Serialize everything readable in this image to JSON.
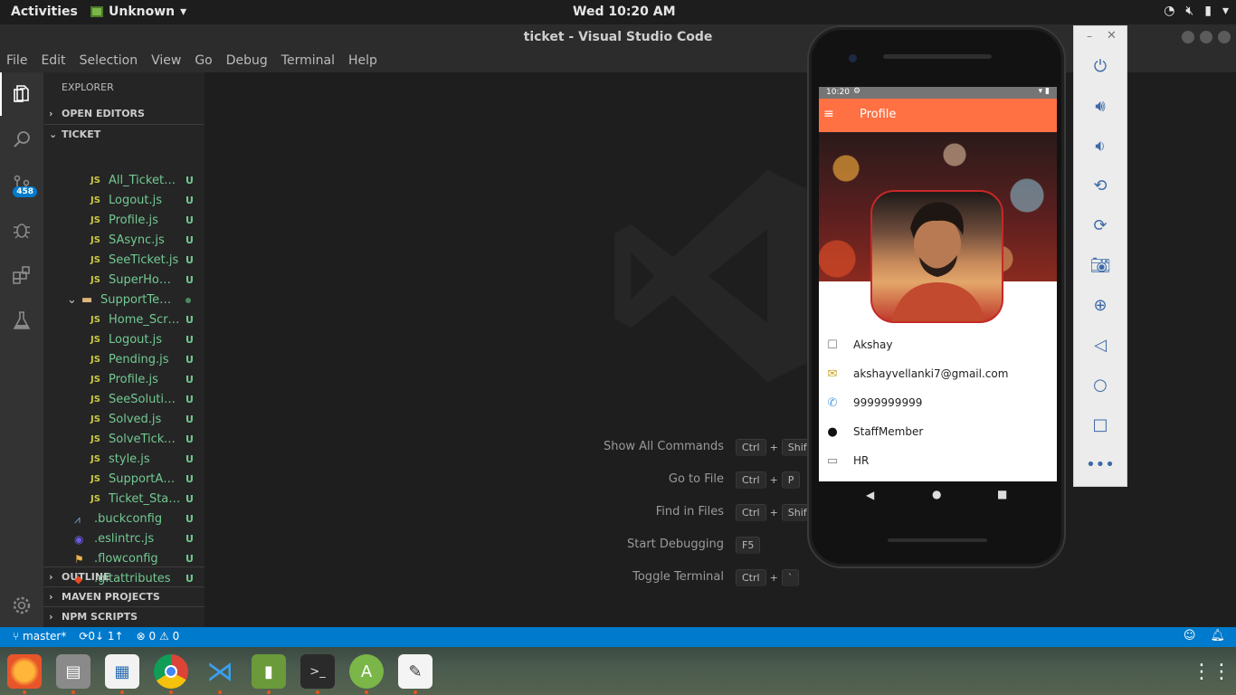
{
  "topbar": {
    "activities": "Activities",
    "app_name": "Unknown",
    "clock": "Wed 10:20 AM"
  },
  "window": {
    "title": "ticket - Visual Studio Code"
  },
  "menu": [
    "File",
    "Edit",
    "Selection",
    "View",
    "Go",
    "Debug",
    "Terminal",
    "Help"
  ],
  "activity": {
    "scm_badge": "458"
  },
  "explorer": {
    "title": "EXPLORER",
    "open_editors": "OPEN EDITORS",
    "project": "TICKET",
    "files": [
      {
        "name": "All_Tickets.js",
        "status": "U"
      },
      {
        "name": "Logout.js",
        "status": "U"
      },
      {
        "name": "Profile.js",
        "status": "U"
      },
      {
        "name": "SAsync.js",
        "status": "U"
      },
      {
        "name": "SeeTicket.js",
        "status": "U"
      },
      {
        "name": "SuperHom…",
        "status": "U"
      }
    ],
    "folder": {
      "name": "SupportTea…"
    },
    "folder_files": [
      {
        "name": "Home_Scre…",
        "status": "U"
      },
      {
        "name": "Logout.js",
        "status": "U"
      },
      {
        "name": "Pending.js",
        "status": "U"
      },
      {
        "name": "Profile.js",
        "status": "U"
      },
      {
        "name": "SeeSolutio…",
        "status": "U"
      },
      {
        "name": "Solved.js",
        "status": "U"
      },
      {
        "name": "SolveTicket…",
        "status": "U"
      },
      {
        "name": "style.js",
        "status": "U"
      },
      {
        "name": "SupportAs…",
        "status": "U"
      },
      {
        "name": "Ticket_Stat…",
        "status": "U"
      }
    ],
    "root_files": [
      {
        "name": ".buckconfig",
        "status": "U"
      },
      {
        "name": ".eslintrc.js",
        "status": "U"
      },
      {
        "name": ".flowconfig",
        "status": "U"
      },
      {
        "name": ".gitattributes",
        "status": "U"
      }
    ],
    "outline": "OUTLINE",
    "maven": "MAVEN PROJECTS",
    "npm": "NPM SCRIPTS",
    "js_label": "JS"
  },
  "welcome": {
    "hints": [
      {
        "label": "Show All Commands",
        "keys": [
          "Ctrl",
          "+",
          "Shift"
        ]
      },
      {
        "label": "Go to File",
        "keys": [
          "Ctrl",
          "+",
          "P"
        ]
      },
      {
        "label": "Find in Files",
        "keys": [
          "Ctrl",
          "+",
          "Shift"
        ]
      },
      {
        "label": "Start Debugging",
        "keys": [
          "F5"
        ]
      },
      {
        "label": "Toggle Terminal",
        "keys": [
          "Ctrl",
          "+",
          "`"
        ]
      }
    ]
  },
  "statusbar": {
    "branch": "master*",
    "sync": "0↓ 1↑",
    "errors": "0",
    "warnings": "0"
  },
  "phone": {
    "time": "10:20",
    "app_title": "Profile",
    "name": "Akshay",
    "email": "akshayvellanki7@gmail.com",
    "phone": "9999999999",
    "role": "StaffMember",
    "department": "HR"
  },
  "colors": {
    "accent": "#007acc",
    "appbar": "#ff7043",
    "git_untracked": "#73c991"
  }
}
